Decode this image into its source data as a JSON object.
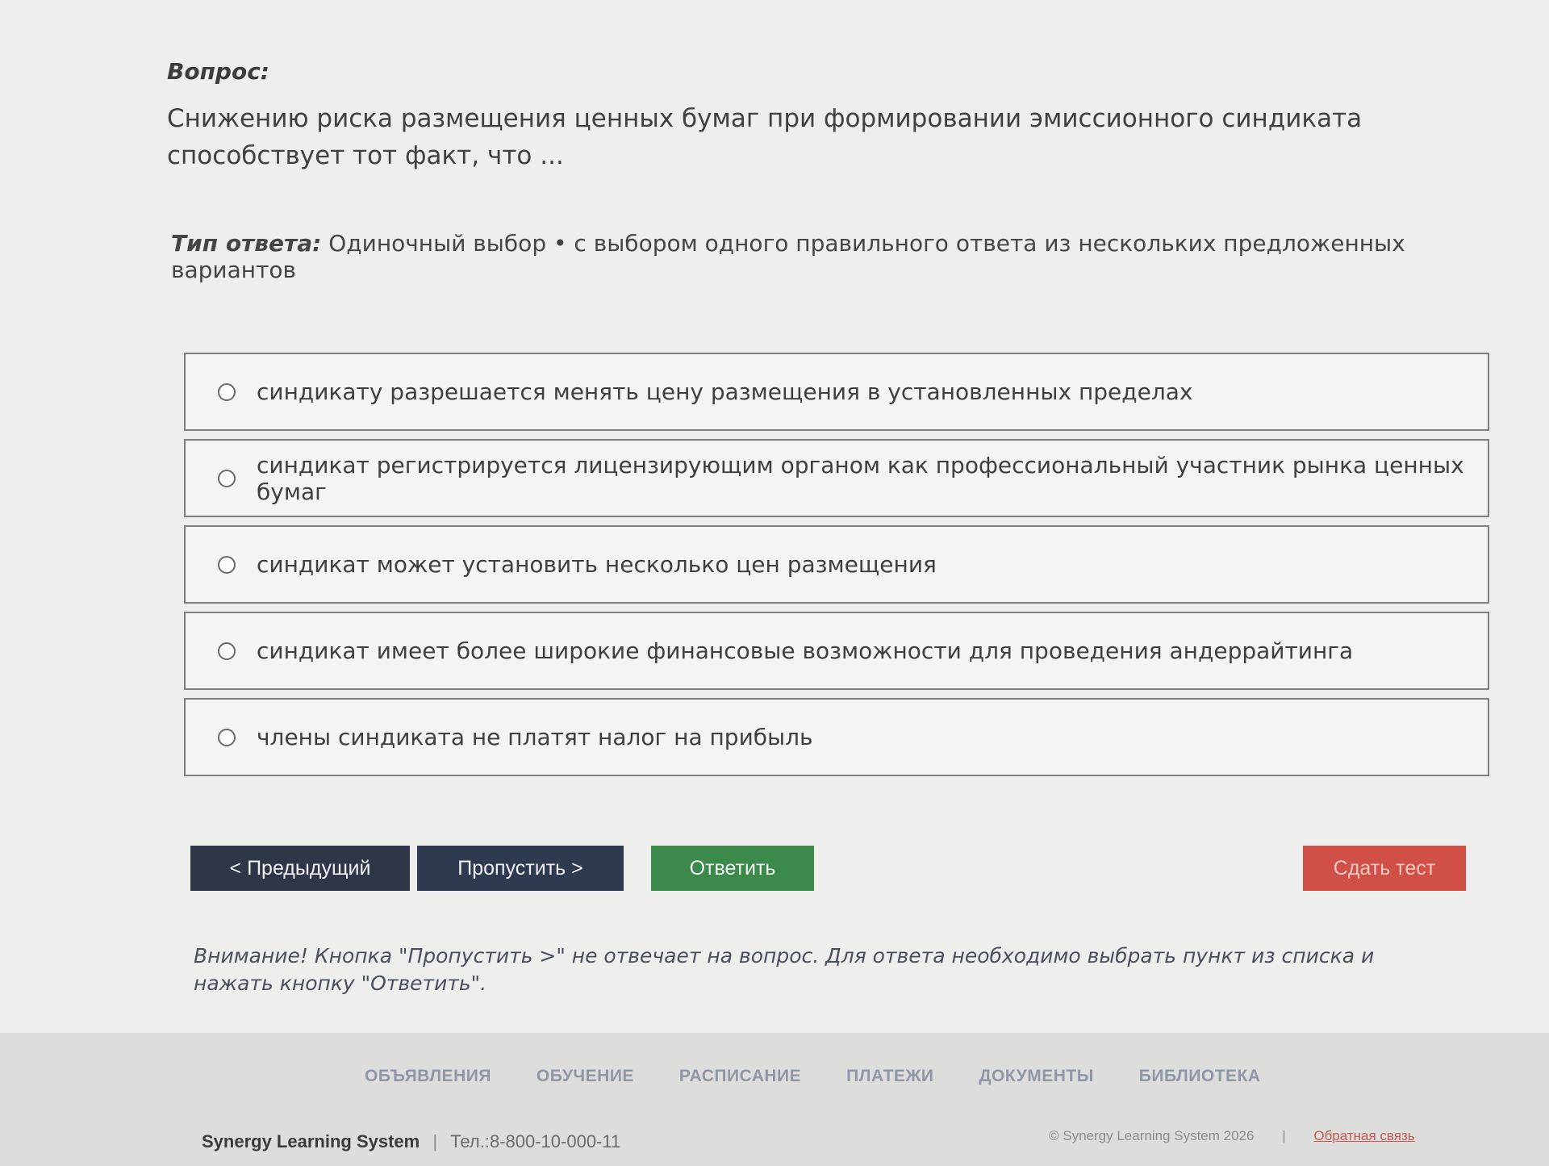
{
  "question": {
    "label": "Вопрос:",
    "text": "Снижению риска размещения ценных бумаг при формировании эмиссионного синдиката способствует тот факт, что ..."
  },
  "answer_type": {
    "label": "Тип ответа:",
    "text": "Одиночный выбор • с выбором одного правильного ответа из нескольких предложенных вариантов"
  },
  "options": [
    {
      "text": "синдикату разрешается менять цену размещения в установленных пределах"
    },
    {
      "text": "синдикат регистрируется лицензирующим органом как профессиональный участник рынка ценных бумаг"
    },
    {
      "text": "синдикат может установить несколько цен размещения"
    },
    {
      "text": "синдикат имеет более широкие финансовые возможности для проведения андеррайтинга"
    },
    {
      "text": "члены синдиката не платят налог на прибыль"
    }
  ],
  "buttons": {
    "prev": "< Предыдущий",
    "skip": "Пропустить >",
    "answer": "Ответить",
    "submit": "Сдать тест"
  },
  "warning": "Внимание! Кнопка \"Пропустить >\" не отвечает на вопрос. Для ответа необходимо выбрать пункт из списка и нажать кнопку \"Ответить\".",
  "footer": {
    "nav": [
      "ОБЪЯВЛЕНИЯ",
      "ОБУЧЕНИЕ",
      "РАСПИСАНИЕ",
      "ПЛАТЕЖИ",
      "ДОКУМЕНТЫ",
      "БИБЛИОТЕКА"
    ],
    "brand": "Synergy Learning System",
    "separator": "|",
    "phone": "Тел.:8-800-10-000-11",
    "copyright": "© Synergy Learning System 2026",
    "feedback": "Обратная связь"
  },
  "colors": {
    "btn_dark": "#2e3648",
    "btn_green": "#3c8a4b",
    "btn_red": "#d04f47"
  }
}
